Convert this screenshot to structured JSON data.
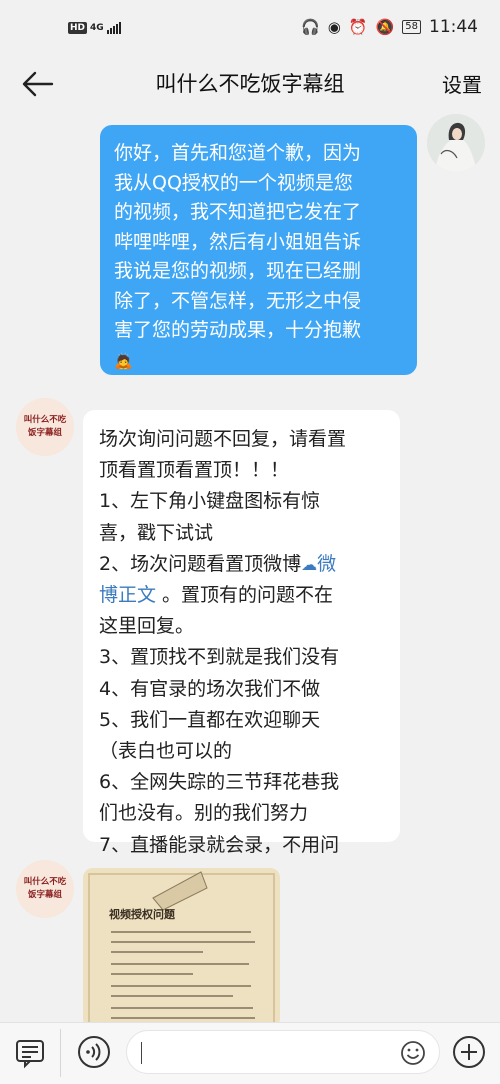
{
  "status_bar": {
    "hd": "HD",
    "network": "4G",
    "battery": "58",
    "time": "11:44"
  },
  "header": {
    "title": "叫什么不吃饭字幕组",
    "settings_label": "设置"
  },
  "messages": {
    "outgoing_lines": [
      "你好，首先和您道个歉，因为",
      "我从QQ授权的一个视频是您",
      "的视频，我不知道把它发在了",
      "哔哩哔哩，然后有小姐姐告诉",
      "我说是您的视频，现在已经删",
      "除了，不管怎样，无形之中侵",
      "害了您的劳动成果，十分抱歉"
    ],
    "outgoing_emoji": "🙇",
    "group_avatar_label": "叫什么不吃饭字幕组",
    "auto_reply": {
      "l1": "场次询问问题不回复，请看置",
      "l2": "顶看置顶看置顶！！！",
      "l3": "1、左下角小键盘图标有惊",
      "l4": "喜，戳下试试",
      "l5a": "2、场次问题看置顶微博",
      "l5link": "微",
      "l6link": "博正文",
      "l6b": " 。置顶有的问题不在",
      "l7": "这里回复。",
      "l8": "3、置顶找不到就是我们没有",
      "l9": "4、有官录的场次我们不做",
      "l10": "5、我们一直都在欢迎聊天",
      "l11": "（表白也可以的",
      "l12": "6、全网失踪的三节拜花巷我",
      "l13": "们也没有。别的我们努力",
      "l14": "7、直播能录就会录，不用问"
    },
    "image_note": {
      "title": "视频授权问题"
    }
  },
  "colors": {
    "outgoing_bubble": "#3fa6f5",
    "link": "#3b7bbf",
    "background": "#f1f1f1"
  }
}
